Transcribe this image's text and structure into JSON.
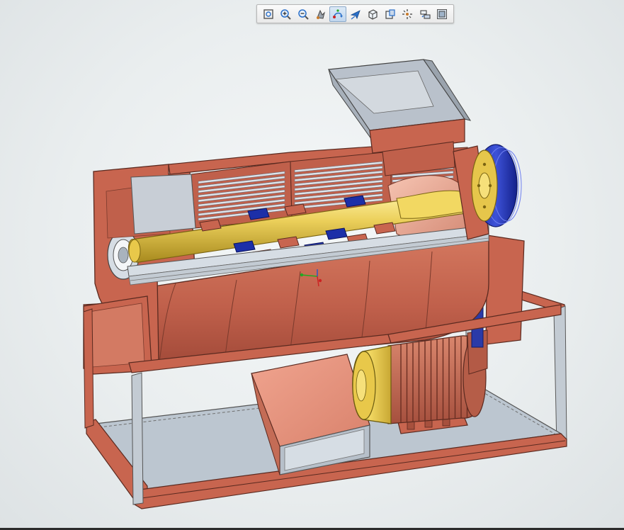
{
  "toolbar": {
    "tools": [
      {
        "icon": "zoom-fit-icon",
        "active": false
      },
      {
        "icon": "zoom-in-icon",
        "active": false
      },
      {
        "icon": "zoom-out-icon",
        "active": false
      },
      {
        "icon": "pan-icon",
        "active": false
      },
      {
        "icon": "rotate-icon",
        "active": true
      },
      {
        "icon": "fly-icon",
        "active": false
      },
      {
        "icon": "view-cube-icon",
        "active": false
      },
      {
        "icon": "section-view-icon",
        "active": false
      },
      {
        "icon": "explode-icon",
        "active": false
      },
      {
        "icon": "measure-icon",
        "active": false
      },
      {
        "icon": "render-mode-icon",
        "active": false
      }
    ]
  },
  "viewport": {
    "model": "threshing-machine-cutaway",
    "colors": {
      "frame": "#c8654f",
      "frame_edge": "#5a2a20",
      "shaft": "#e8c84a",
      "beaters": "#1c2fa8",
      "grate": "#cdd4dc",
      "hopper": "#b9c1cb",
      "motor": "#c9725a",
      "motor_cap": "#e6c64b",
      "base": "#bcc6d0"
    }
  }
}
